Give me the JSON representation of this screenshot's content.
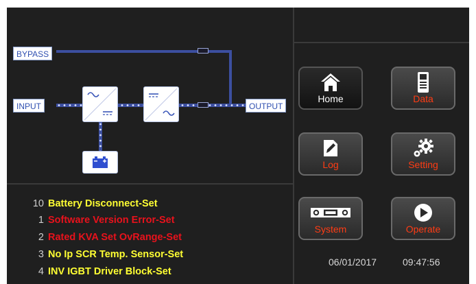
{
  "colors": {
    "background": "#1f1f1f",
    "alarm_yellow": "#ffff33",
    "alarm_red": "#e8121c",
    "accent_orange": "#ff3c14",
    "button_label_white": "#ffffff",
    "line_blue": "#3c4fa0"
  },
  "diagram": {
    "bypass_label": "BYPASS",
    "input_label": "INPUT",
    "output_label": "OUTPUT"
  },
  "alarms": [
    {
      "num": "10",
      "text": "Battery Disconnect-Set",
      "color": "yellow"
    },
    {
      "num": "1",
      "text": "Software Version Error-Set",
      "color": "red"
    },
    {
      "num": "2",
      "text": "Rated KVA Set OvRange-Set",
      "color": "red"
    },
    {
      "num": "3",
      "text": "No Ip SCR Temp. Sensor-Set",
      "color": "yellow"
    },
    {
      "num": "4",
      "text": "INV IGBT Driver Block-Set",
      "color": "yellow"
    }
  ],
  "menu": {
    "home": {
      "label": "Home",
      "icon": "home-icon"
    },
    "data": {
      "label": "Data",
      "icon": "meter-icon"
    },
    "log": {
      "label": "Log",
      "icon": "log-edit-icon"
    },
    "setting": {
      "label": "Setting",
      "icon": "gears-icon"
    },
    "system": {
      "label": "System",
      "icon": "system-panel-icon"
    },
    "operate": {
      "label": "Operate",
      "icon": "play-icon"
    }
  },
  "status": {
    "date": "06/01/2017",
    "time": "09:47:56"
  }
}
